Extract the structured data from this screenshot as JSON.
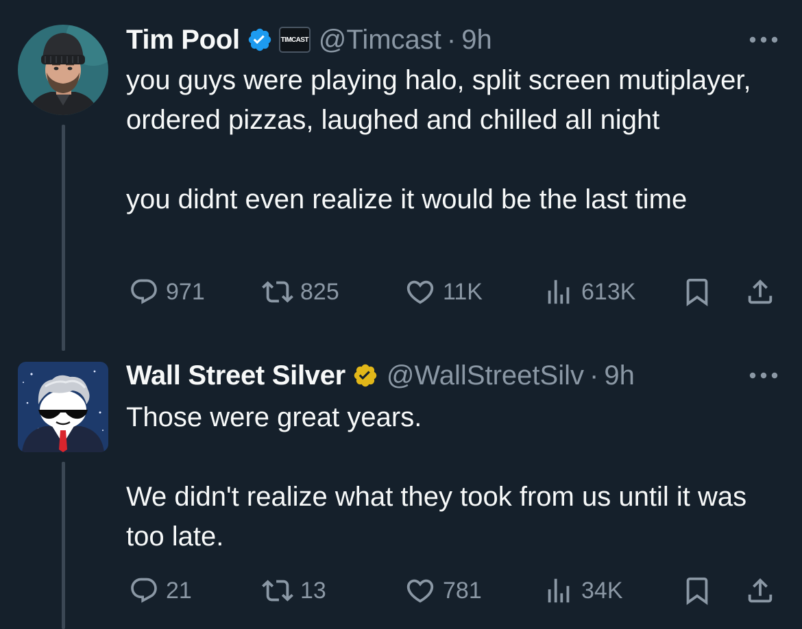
{
  "tweets": [
    {
      "display_name": "Tim Pool",
      "affiliate_label": "TIMCAST",
      "handle": "@Timcast",
      "separator": "·",
      "time": "9h",
      "text": "you guys were playing halo, split screen mutiplayer, ordered pizzas, laughed and chilled all night\n\nyou didnt even realize it would be the last time",
      "verified_color": "#1d9bf0",
      "reply_count": "971",
      "retweet_count": "825",
      "like_count": "11K",
      "view_count": "613K",
      "icons": [
        "more-icon",
        "reply-icon",
        "retweet-icon",
        "like-icon",
        "views-icon",
        "bookmark-icon",
        "share-icon"
      ]
    },
    {
      "display_name": "Wall Street Silver",
      "handle": "@WallStreetSilv",
      "separator": "·",
      "time": "9h",
      "text": "Those were great years.\n\nWe didn't realize what they took from us until it was too late.",
      "verified_color": "#e2b719",
      "reply_count": "21",
      "retweet_count": "13",
      "like_count": "781",
      "view_count": "34K",
      "icons": [
        "more-icon",
        "reply-icon",
        "retweet-icon",
        "like-icon",
        "views-icon",
        "bookmark-icon",
        "share-icon"
      ]
    }
  ],
  "colors": {
    "background": "#15202b",
    "text_primary": "#f7f9f9",
    "text_secondary": "#8b98a5",
    "thread_line": "#3b4754"
  }
}
